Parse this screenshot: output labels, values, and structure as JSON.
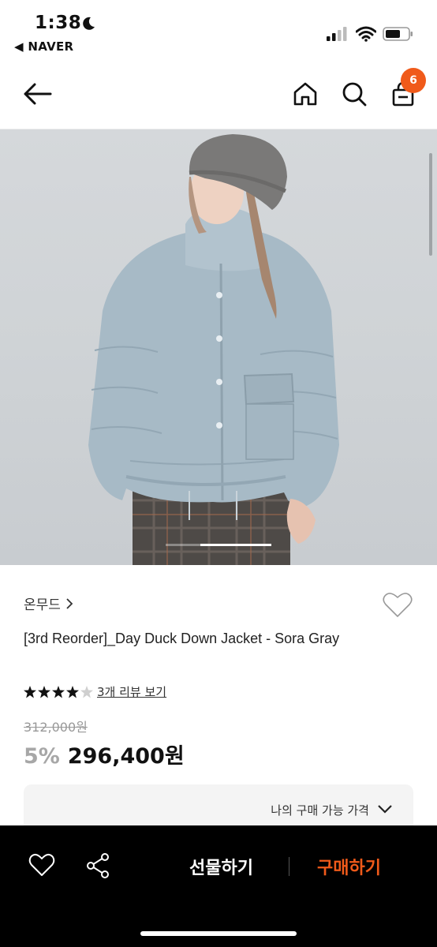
{
  "status_bar": {
    "time": "1:38",
    "back_app": "◀ NAVER"
  },
  "navbar": {
    "cart_count": "6"
  },
  "product": {
    "brand": "온무드",
    "title": "[3rd Reorder]_Day Duck Down Jacket - Sora Gray",
    "rating": 4.5,
    "review_link": "3개 리뷰 보기",
    "original_price": "312,000원",
    "discount": "5%",
    "price": "296,400원",
    "my_price_label": "나의 구매 가능 가격"
  },
  "bottom_bar": {
    "gift_label": "선물하기",
    "buy_label": "구매하기"
  },
  "colors": {
    "accent": "#f05a1a",
    "bar_bg": "#000000"
  },
  "icons": [
    "moon-icon",
    "signal-icon",
    "wifi-icon",
    "battery-icon",
    "back-arrow-icon",
    "home-icon",
    "search-icon",
    "cart-icon",
    "chevron-right-icon",
    "heart-icon",
    "star-icon",
    "chevron-down-icon",
    "share-icon"
  ]
}
